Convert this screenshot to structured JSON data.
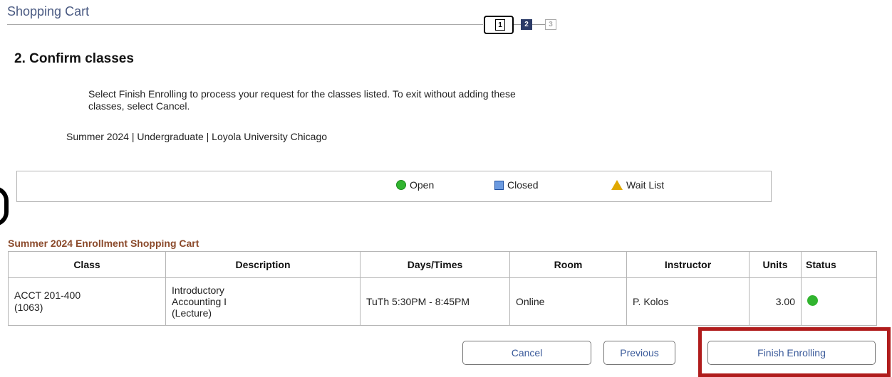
{
  "page": {
    "title": "Shopping Cart"
  },
  "steps": [
    "1",
    "2",
    "3"
  ],
  "heading": "2.  Confirm classes",
  "instructions": "Select Finish Enrolling to process your request for the classes listed. To exit without adding these classes, select Cancel.",
  "term_line": "Summer 2024 | Undergraduate | Loyola University Chicago",
  "legend": {
    "open": "Open",
    "closed": "Closed",
    "wait_list": "Wait List"
  },
  "cart": {
    "title": "Summer 2024 Enrollment Shopping Cart",
    "columns": [
      "Class",
      "Description",
      "Days/Times",
      "Room",
      "Instructor",
      "Units",
      "Status"
    ],
    "rows": [
      {
        "class_code": "ACCT 201-400",
        "class_number": "(1063)",
        "description_lines": [
          "Introductory",
          "Accounting I",
          "(Lecture)"
        ],
        "days_times": "TuTh 5:30PM - 8:45PM",
        "room": "Online",
        "instructor": "P. Kolos",
        "units": "3.00",
        "status_icon": "open-status-icon"
      }
    ]
  },
  "buttons": {
    "cancel": "Cancel",
    "previous": "Previous",
    "finish": "Finish Enrolling"
  },
  "colors": {
    "open": "#31b42f",
    "closed": "#6b9ae0",
    "wait_list": "#e0a800",
    "highlight": "#b01c1c",
    "title": "#4a5a82",
    "cart_title": "#8b4a2b"
  }
}
